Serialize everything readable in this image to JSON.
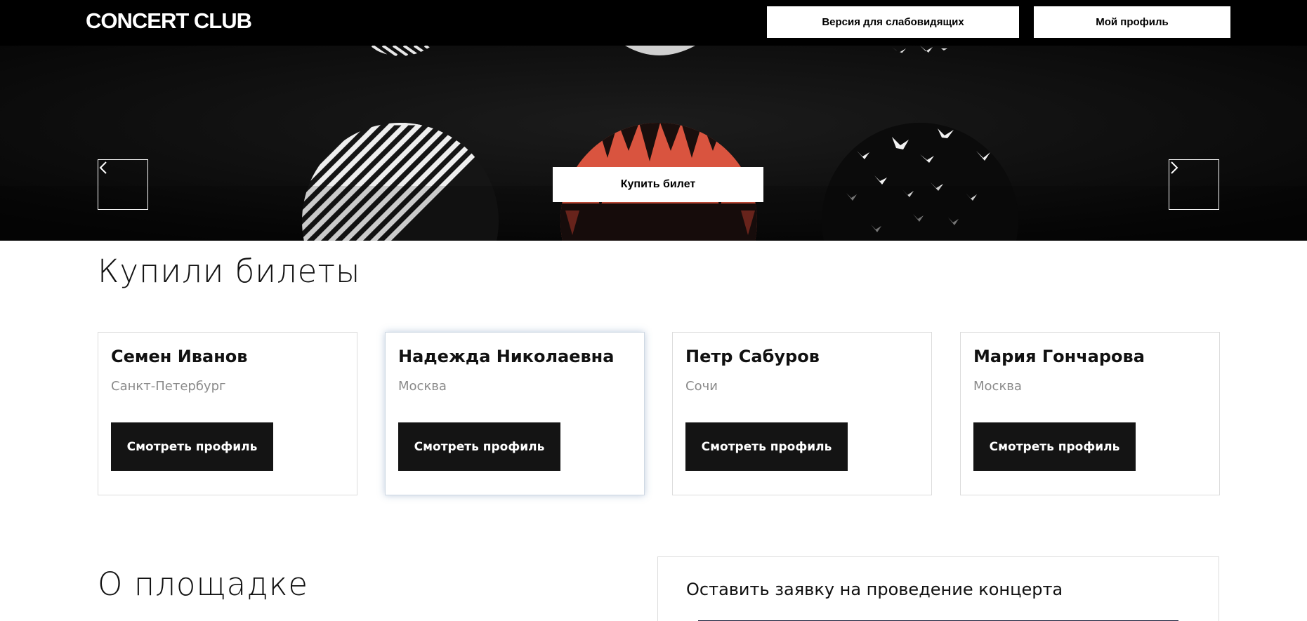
{
  "header": {
    "logo": "CONCERT CLUB",
    "vision_button": "Версия для слабовидящих",
    "profile_button": "Мой профиль"
  },
  "hero": {
    "buy_button": "Купить билет",
    "prev_icon": "chevron-left-icon",
    "next_icon": "chevron-right-icon"
  },
  "bought": {
    "title": "Купили билеты",
    "cards": [
      {
        "name": "Семен Иванов",
        "city": "Санкт-Петербург",
        "button": "Смотреть профиль"
      },
      {
        "name": "Надежда Николаевна",
        "city": "Москва",
        "button": "Смотреть профиль"
      },
      {
        "name": "Петр Сабуров",
        "city": "Сочи",
        "button": "Смотреть профиль"
      },
      {
        "name": "Мария Гончарова",
        "city": "Москва",
        "button": "Смотреть профиль"
      }
    ]
  },
  "venue": {
    "title": "О площадке"
  },
  "request": {
    "title": "Оставить заявку на проведение концерта"
  },
  "colors": {
    "header_bg": "#000000",
    "hero_bg": "#101010",
    "accent_red": "#d9543f",
    "button_dark": "#141414",
    "muted_text": "#8a8a8a"
  }
}
